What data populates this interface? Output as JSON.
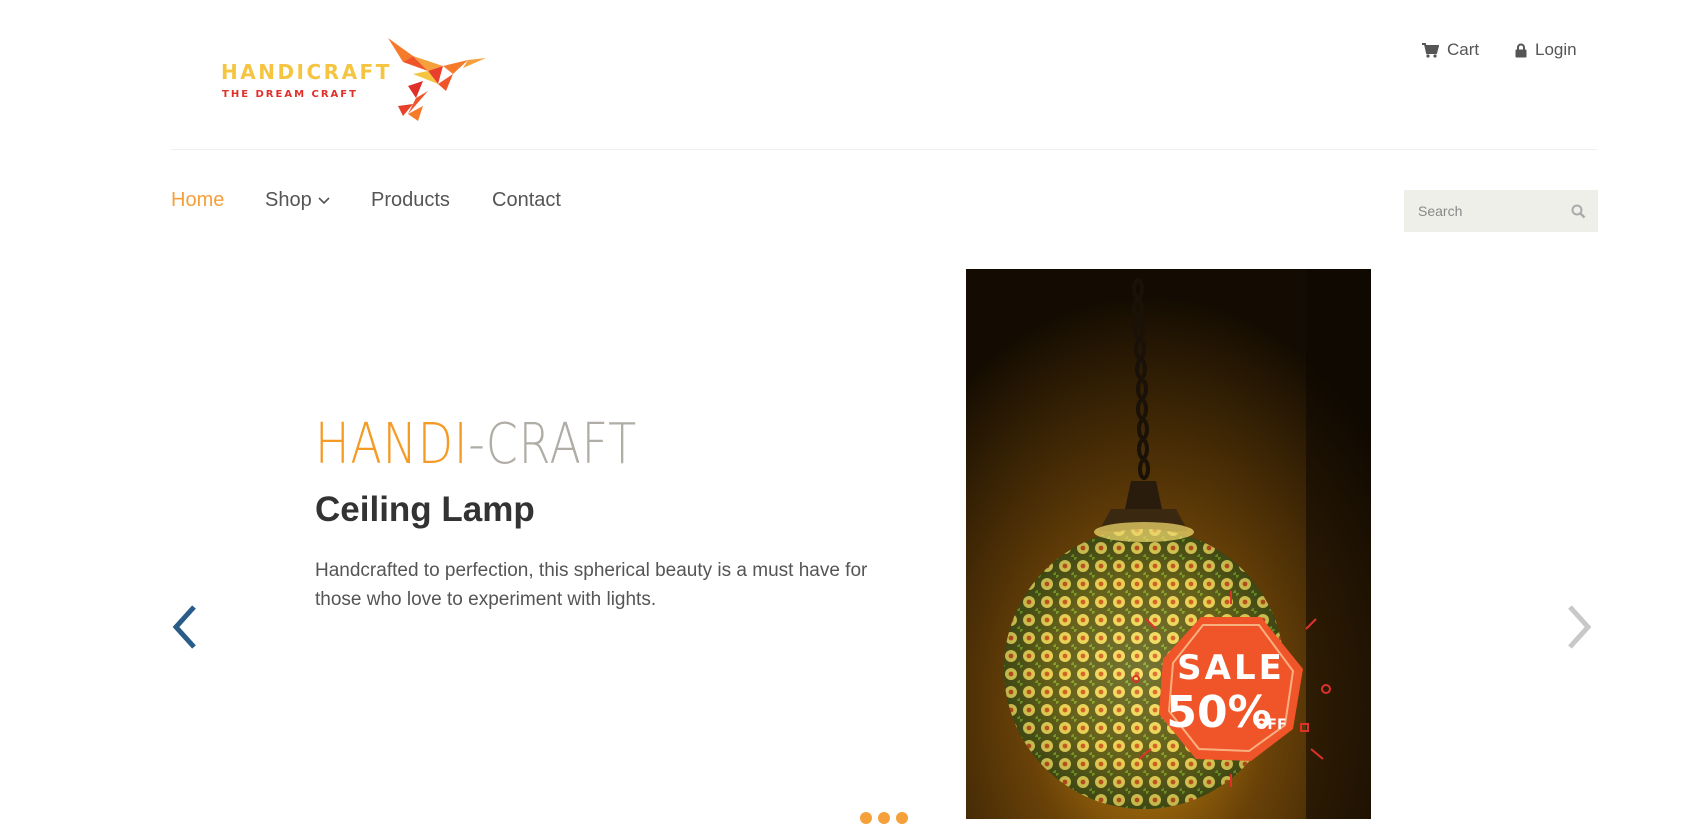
{
  "header": {
    "logo": {
      "brand": "HANDICRAFT",
      "tagline": "THE DREAM CRAFT",
      "icon": "hummingbird-logo"
    },
    "cart_label": "Cart",
    "login_label": "Login",
    "cart_icon": "cart-icon",
    "login_icon": "lock-icon"
  },
  "nav": {
    "items": [
      {
        "label": "Home",
        "active": true
      },
      {
        "label": "Shop",
        "has_dropdown": true
      },
      {
        "label": "Products"
      },
      {
        "label": "Contact"
      }
    ]
  },
  "search": {
    "placeholder": "Search",
    "value": "",
    "icon": "search-icon"
  },
  "slider": {
    "brand_part1": "HANDI",
    "brand_sep": "-",
    "brand_part2": "CRAFT",
    "title": "Ceiling Lamp",
    "description": "Handcrafted to perfection, this spherical beauty is a must have for those who love to experiment with lights.",
    "badge_line1": "SALE",
    "badge_line2": "50%",
    "badge_line3": "OFF",
    "prev_icon": "chevron-left-icon",
    "next_icon": "chevron-right-icon"
  },
  "colors": {
    "accent": "#f5a03a",
    "brand_gray": "#b0aca6",
    "prev_arrow": "#2a5c8a",
    "next_arrow": "#c8c8c8",
    "search_bg": "#efefe9",
    "badge": "#f0552a"
  }
}
